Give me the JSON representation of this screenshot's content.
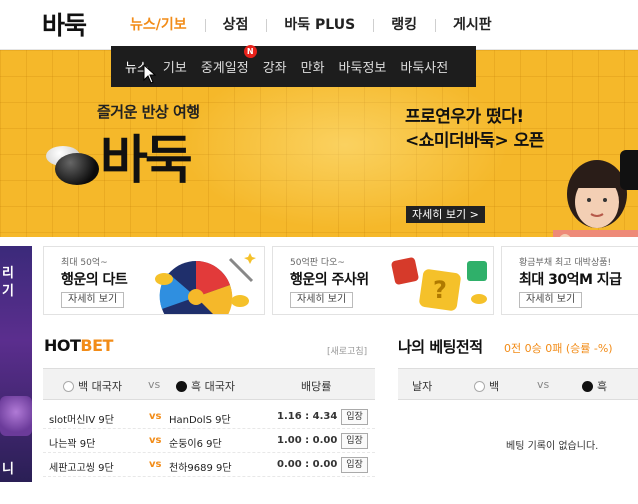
{
  "logo": "바둑",
  "nav": {
    "items": [
      "뉴스/기보",
      "상점",
      "바둑 PLUS",
      "랭킹",
      "게시판"
    ],
    "active_index": 0
  },
  "submenu": {
    "items": [
      "뉴스",
      "기보",
      "중계일정",
      "강좌",
      "만화",
      "바둑정보",
      "바둑사전"
    ],
    "badge_on_index": 2,
    "badge_text": "N"
  },
  "banner": {
    "subtitle": "즐거운 반상 여행",
    "title": "바둑",
    "promo_line1": "프로연우가 떴다!",
    "promo_line2": "<쇼미더바둑> 오픈",
    "promo_button": "자세히 보기 >"
  },
  "left_ad": {
    "line1": "리",
    "line2": "기",
    "bottom": "니"
  },
  "cards": [
    {
      "small": "최대 50억~",
      "big": "행운의 다트",
      "button": "자세히 보기"
    },
    {
      "small": "50억판 다오~",
      "big": "행운의 주사위",
      "button": "자세히 보기"
    },
    {
      "small": "황금부채 최고 대박상품!",
      "big": "최대 30억M 지급",
      "button": "자세히 보기"
    }
  ],
  "hotbet": {
    "title_hot": "HOT",
    "title_bet": "BET",
    "refresh": "[새로고침]",
    "headers": {
      "white": "백 대국자",
      "vs": "vs",
      "black": "흑 대국자",
      "odds": "배당률"
    },
    "rows": [
      {
        "white": "slot머신IV 9단",
        "vs": "vs",
        "black": "HanDolS 9단",
        "odds": "1.16 : 4.34",
        "button": "입장"
      },
      {
        "white": "나는꽉 9단",
        "vs": "vs",
        "black": "순둥이6 9단",
        "odds": "1.00 : 0.00",
        "button": "입장"
      },
      {
        "white": "세판고고씽 9단",
        "vs": "vs",
        "black": "천하9689 9단",
        "odds": "0.00 : 0.00",
        "button": "입장"
      }
    ]
  },
  "mybet": {
    "title": "나의 베팅전적",
    "record": "0전 0승 0패 (승률 -%)",
    "headers": {
      "date": "날자",
      "white": "백",
      "vs": "vs",
      "black": "흑"
    },
    "empty": "베팅 기록이 없습니다."
  },
  "colors": {
    "accent": "#f28c18",
    "banner": "#f5b82a",
    "submenu": "#1d1d1d"
  }
}
